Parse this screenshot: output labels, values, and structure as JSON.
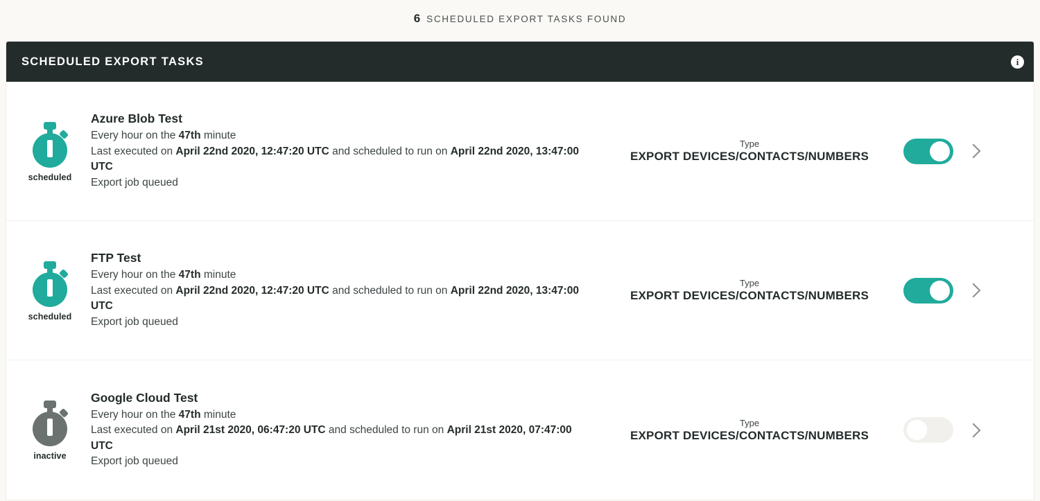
{
  "header": {
    "count": "6",
    "count_text": "scheduled export tasks found"
  },
  "card": {
    "title": "Scheduled Export Tasks",
    "info_icon": "info-icon",
    "info_glyph": "i"
  },
  "colors": {
    "accent_teal": "#20ab9c",
    "header_dark": "#242b2b",
    "inactive_gray": "#6b7270",
    "page_bg": "#faf9f5",
    "toggle_off": "#f1f0ec"
  },
  "column_labels": {
    "type": "Type"
  },
  "tasks": [
    {
      "name": "Azure Blob Test",
      "state": "scheduled",
      "state_color": "#20ab9c",
      "schedule_prefix": "Every hour on the ",
      "schedule_bold": "47th",
      "schedule_suffix": " minute",
      "exec_prefix": "Last executed on ",
      "exec_bold": "April 22nd 2020, 12:47:20 UTC",
      "exec_middle": " and scheduled to run on ",
      "next_bold": "April 22nd 2020, 13:47:00 UTC",
      "status": "Export job queued",
      "type_value": "Export Devices/Contacts/Numbers",
      "enabled": true,
      "chevron": "chevron-right-icon"
    },
    {
      "name": "FTP Test",
      "state": "scheduled",
      "state_color": "#20ab9c",
      "schedule_prefix": "Every hour on the ",
      "schedule_bold": "47th",
      "schedule_suffix": " minute",
      "exec_prefix": "Last executed on ",
      "exec_bold": "April 22nd 2020, 12:47:20 UTC",
      "exec_middle": " and scheduled to run on ",
      "next_bold": "April 22nd 2020, 13:47:00 UTC",
      "status": "Export job queued",
      "type_value": "Export Devices/Contacts/Numbers",
      "enabled": true,
      "chevron": "chevron-right-icon"
    },
    {
      "name": "Google Cloud Test",
      "state": "inactive",
      "state_color": "#6b7270",
      "schedule_prefix": "Every hour on the ",
      "schedule_bold": "47th",
      "schedule_suffix": " minute",
      "exec_prefix": "Last executed on ",
      "exec_bold": "April 21st 2020, 06:47:20 UTC",
      "exec_middle": " and scheduled to run on ",
      "next_bold": "April 21st 2020, 07:47:00 UTC",
      "status": "Export job queued",
      "type_value": "Export Devices/Contacts/Numbers",
      "enabled": false,
      "chevron": "chevron-right-icon"
    }
  ]
}
